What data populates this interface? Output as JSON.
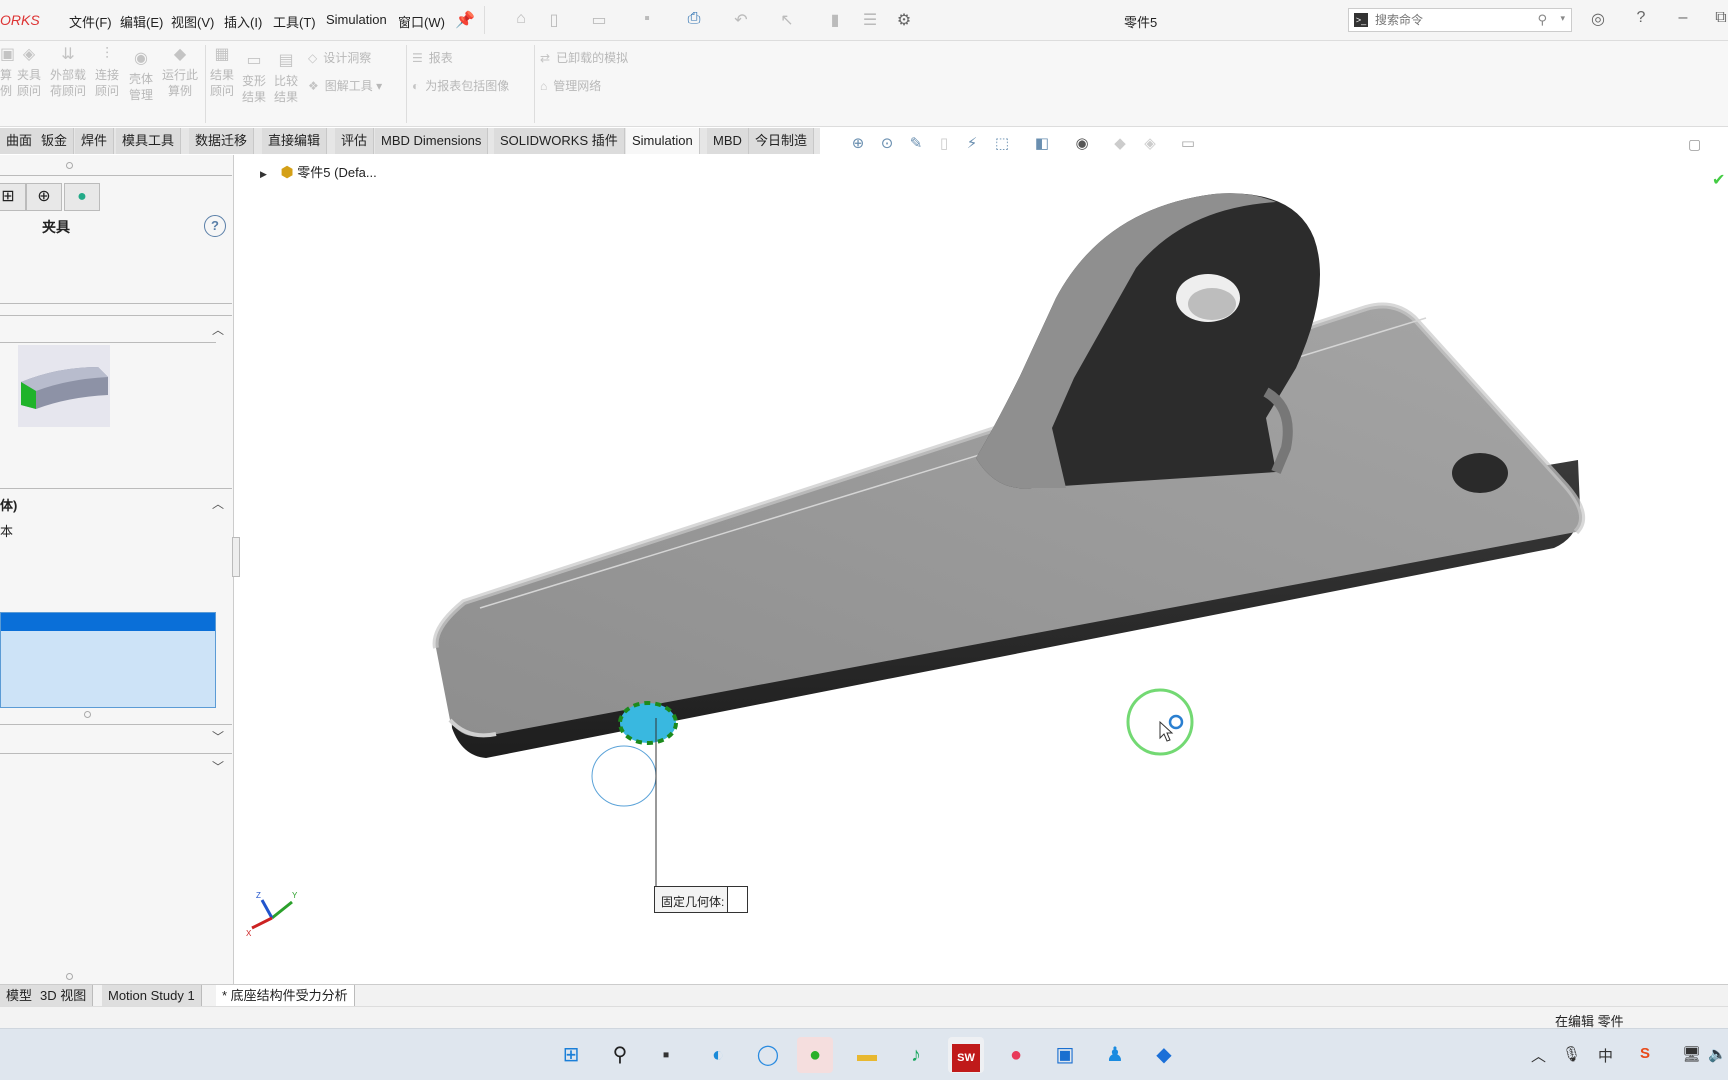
{
  "app": {
    "logo_text": "ORKS",
    "document_title": "零件5",
    "menu": [
      "文件(F)",
      "编辑(E)",
      "视图(V)",
      "插入(I)",
      "工具(T)",
      "Simulation",
      "窗口(W)"
    ],
    "quick_icons": [
      "pin-icon",
      "home-icon",
      "new-file-icon",
      "open-folder-icon",
      "save-icon",
      "print-icon",
      "undo-icon",
      "select-icon",
      "rebuild-icon",
      "file-properties-icon",
      "options-gear-icon"
    ],
    "search": {
      "placeholder": "搜索命令"
    }
  },
  "ribbon": {
    "buttons_left": [
      {
        "label": "算例",
        "icon": "study-icon"
      },
      {
        "label": "夹具顾问",
        "icon": "fixture-advisor-icon"
      },
      {
        "label": "外部载荷顾问",
        "icon": "external-loads-icon"
      },
      {
        "label": "连接顾问",
        "icon": "connections-advisor-icon"
      },
      {
        "label": "壳体管理",
        "icon": "shell-manager-icon"
      },
      {
        "label": "运行此算例",
        "icon": "run-study-icon"
      }
    ],
    "buttons_mid": [
      {
        "label": "结果顾问",
        "icon": "results-advisor-icon"
      },
      {
        "label": "变形结果",
        "icon": "deformed-result-icon"
      },
      {
        "label": "比较结果",
        "icon": "compare-results-icon"
      }
    ],
    "small_buttons": [
      {
        "label": "设计洞察",
        "icon": "design-insight-icon"
      },
      {
        "label": "图解工具",
        "icon": "plot-tools-icon"
      },
      {
        "label": "报表",
        "icon": "report-icon"
      },
      {
        "label": "为报表包括图像",
        "icon": "include-image-icon"
      },
      {
        "label": "已卸载的模拟",
        "icon": "offloaded-sim-icon"
      },
      {
        "label": "管理网络",
        "icon": "manage-network-icon"
      }
    ]
  },
  "command_tabs": [
    {
      "label": "曲面",
      "active": false
    },
    {
      "label": "钣金",
      "active": false
    },
    {
      "label": "焊件",
      "active": false
    },
    {
      "label": "模具工具",
      "active": false
    },
    {
      "label": "数据迁移",
      "active": false
    },
    {
      "label": "直接编辑",
      "active": false
    },
    {
      "label": "评估",
      "active": false
    },
    {
      "label": "MBD Dimensions",
      "active": false
    },
    {
      "label": "SOLIDWORKS 插件",
      "active": false
    },
    {
      "label": "Simulation",
      "active": true
    },
    {
      "label": "MBD",
      "active": false
    },
    {
      "label": "今日制造",
      "active": false
    }
  ],
  "left_panel": {
    "title": "夹具",
    "help": "?",
    "section_label": "体)",
    "option_1": "本",
    "selection_list": []
  },
  "feature_tree": {
    "root_label": "零件5  (Defa..."
  },
  "viewport": {
    "callout_label": "固定几何体:",
    "triad_labels": {
      "x": "X",
      "y": "Y",
      "z": "Z"
    }
  },
  "bottom_tabs": [
    {
      "label": "模型",
      "active": false
    },
    {
      "label": "3D 视图",
      "active": false
    },
    {
      "label": "Motion Study 1",
      "active": false
    },
    {
      "label": "* 底座结构件受力分析",
      "active": true
    }
  ],
  "status": {
    "text": "在编辑 零件"
  },
  "taskbar": {
    "apps": [
      "windows-start",
      "search",
      "task-view",
      "edge",
      "chat",
      "wechat",
      "file-explorer",
      "music",
      "solidworks-2020",
      "screen-recorder",
      "video-app",
      "qq",
      "feishu"
    ],
    "solidworks_badge": "SW",
    "tray": [
      "chevron-up",
      "microphone",
      "input-method",
      "sogou",
      "network",
      "volume"
    ],
    "ime_label": "中"
  }
}
